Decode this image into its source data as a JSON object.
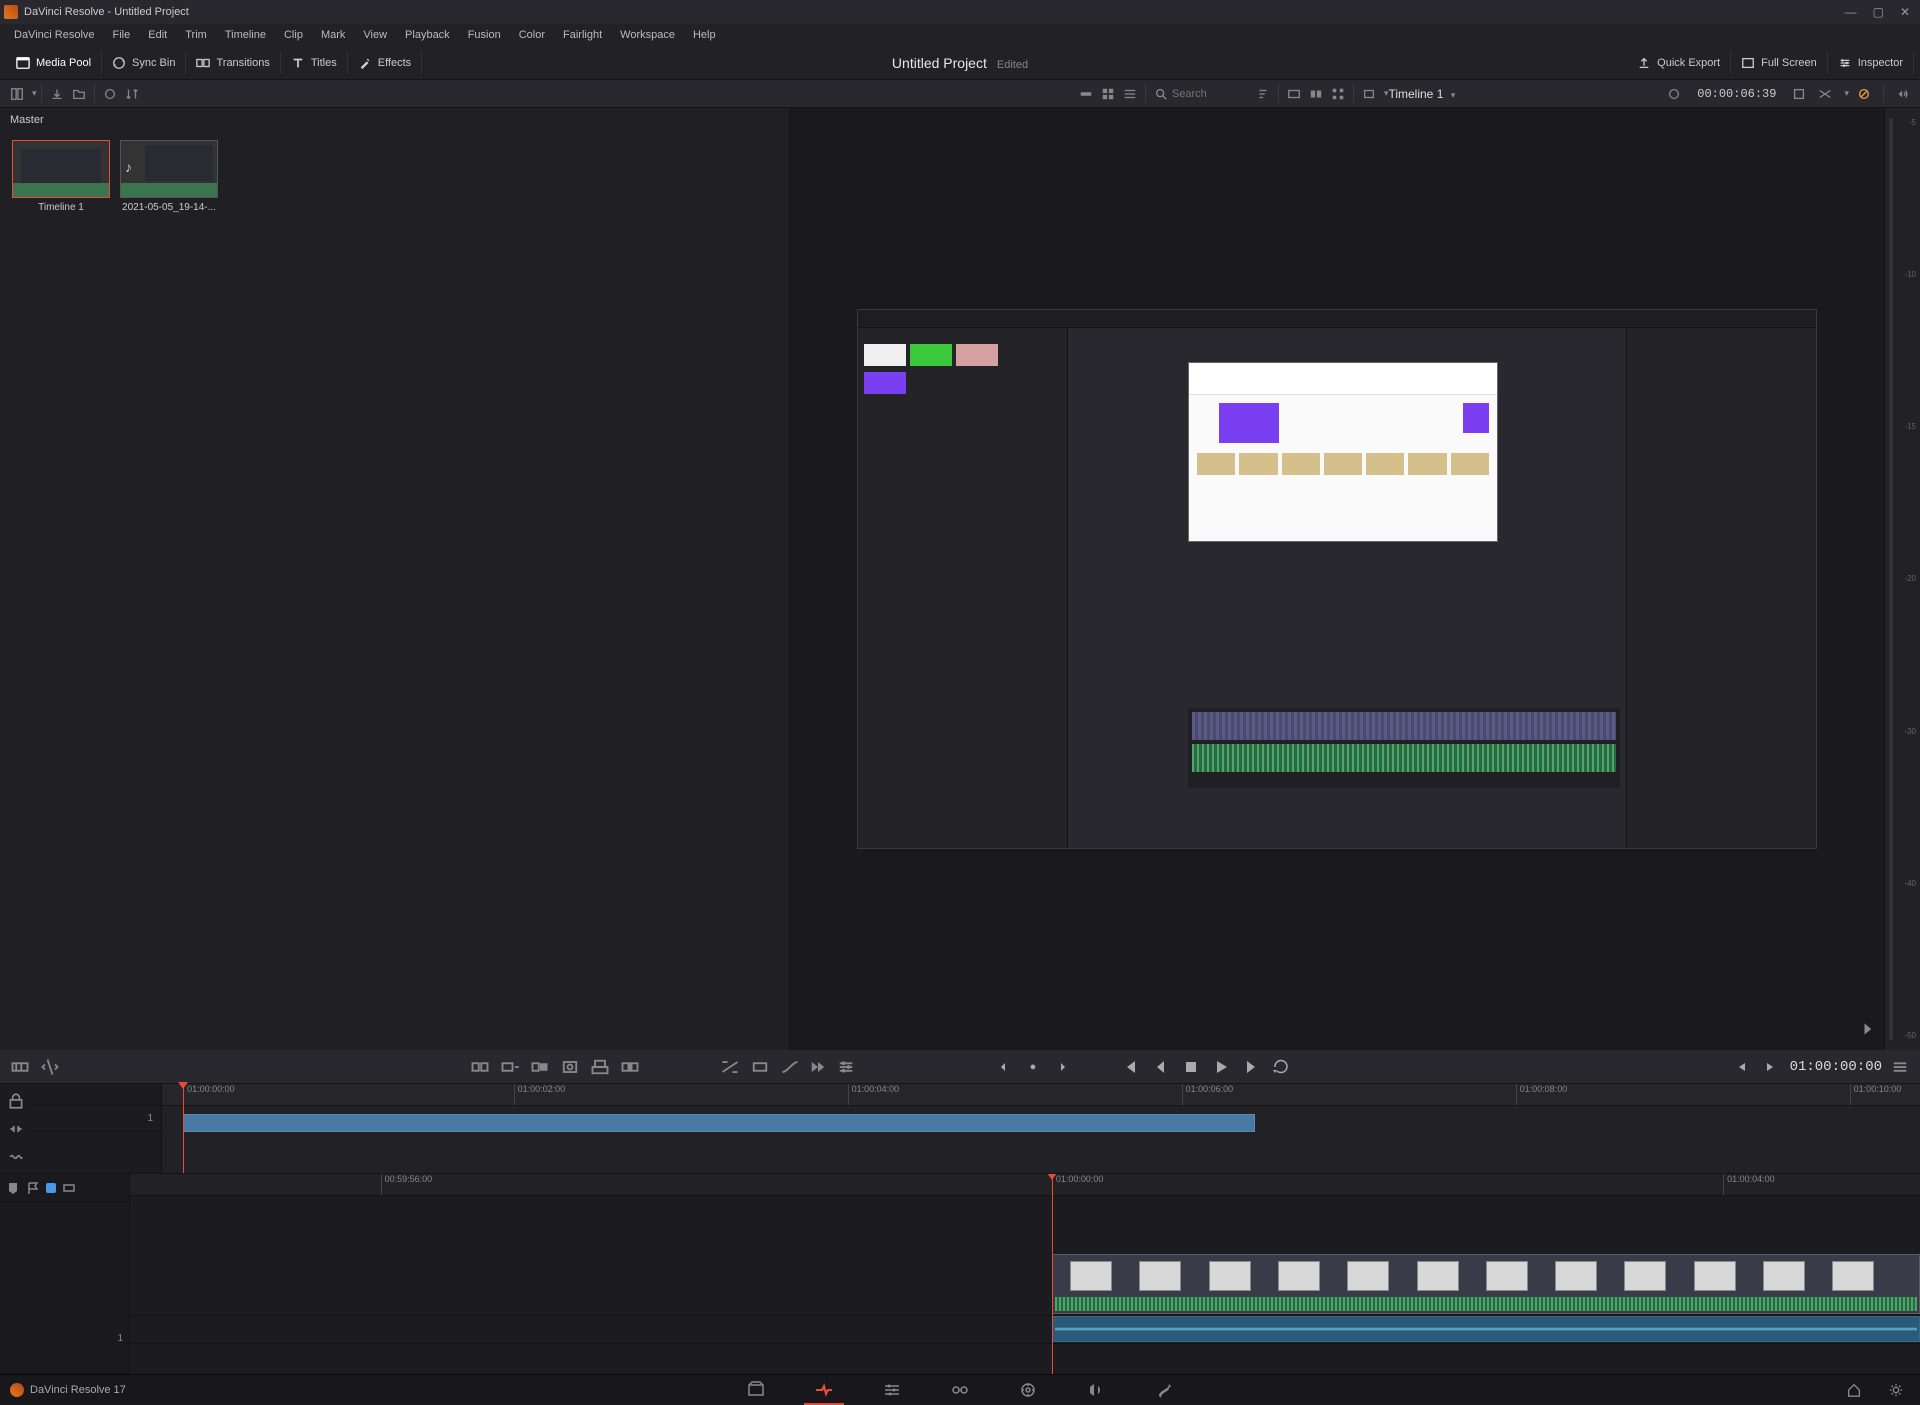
{
  "window": {
    "title": "DaVinci Resolve - Untitled Project"
  },
  "menu": [
    "DaVinci Resolve",
    "File",
    "Edit",
    "Trim",
    "Timeline",
    "Clip",
    "Mark",
    "View",
    "Playback",
    "Fusion",
    "Color",
    "Fairlight",
    "Workspace",
    "Help"
  ],
  "toolbar": {
    "media_pool": "Media Pool",
    "sync_bin": "Sync Bin",
    "transitions": "Transitions",
    "titles": "Titles",
    "effects": "Effects",
    "quick_export": "Quick Export",
    "full_screen": "Full Screen",
    "inspector": "Inspector"
  },
  "project": {
    "name": "Untitled Project",
    "status": "Edited"
  },
  "subbar": {
    "search_placeholder": "Search",
    "timeline_name": "Timeline 1",
    "source_tc": "00:00:06:39"
  },
  "mediapool": {
    "bin": "Master",
    "clips": [
      {
        "label": "Timeline 1",
        "selected": true
      },
      {
        "label": "2021-05-05_19-14-...",
        "selected": false
      }
    ]
  },
  "transport": {
    "record_tc": "01:00:00:00"
  },
  "upper_timeline": {
    "ticks": [
      "01:00:00:00",
      "01:00:02:00",
      "01:00:04:00",
      "01:00:06:00",
      "01:00:08:00",
      "01:00:10:00"
    ],
    "playhead_pos_pct": 1.2,
    "clip": {
      "left_pct": 1.2,
      "width_pct": 61
    },
    "track_label": "1"
  },
  "lower_timeline": {
    "ticks": [
      "00:59:56:00",
      "01:00:00:00",
      "01:00:04:00"
    ],
    "playhead_pos_pct": 51.5,
    "track_label": "1",
    "video_clips": [
      {
        "left_pct": 51.5,
        "width_pct": 48.5,
        "thumbs_at_pct": [
          2,
          10,
          18,
          26,
          34,
          42,
          50,
          58,
          66,
          74,
          82,
          90
        ]
      }
    ],
    "audio_clip": {
      "left_pct": 51.5,
      "width_pct": 48.5
    }
  },
  "meters": {
    "scale": [
      "-5",
      "-10",
      "-15",
      "-20",
      "-30",
      "-40",
      "-50"
    ]
  },
  "footer": {
    "app": "DaVinci Resolve 17"
  },
  "colors": {
    "accent": "#e64b3c",
    "clip_blue": "#4a7aa3"
  }
}
